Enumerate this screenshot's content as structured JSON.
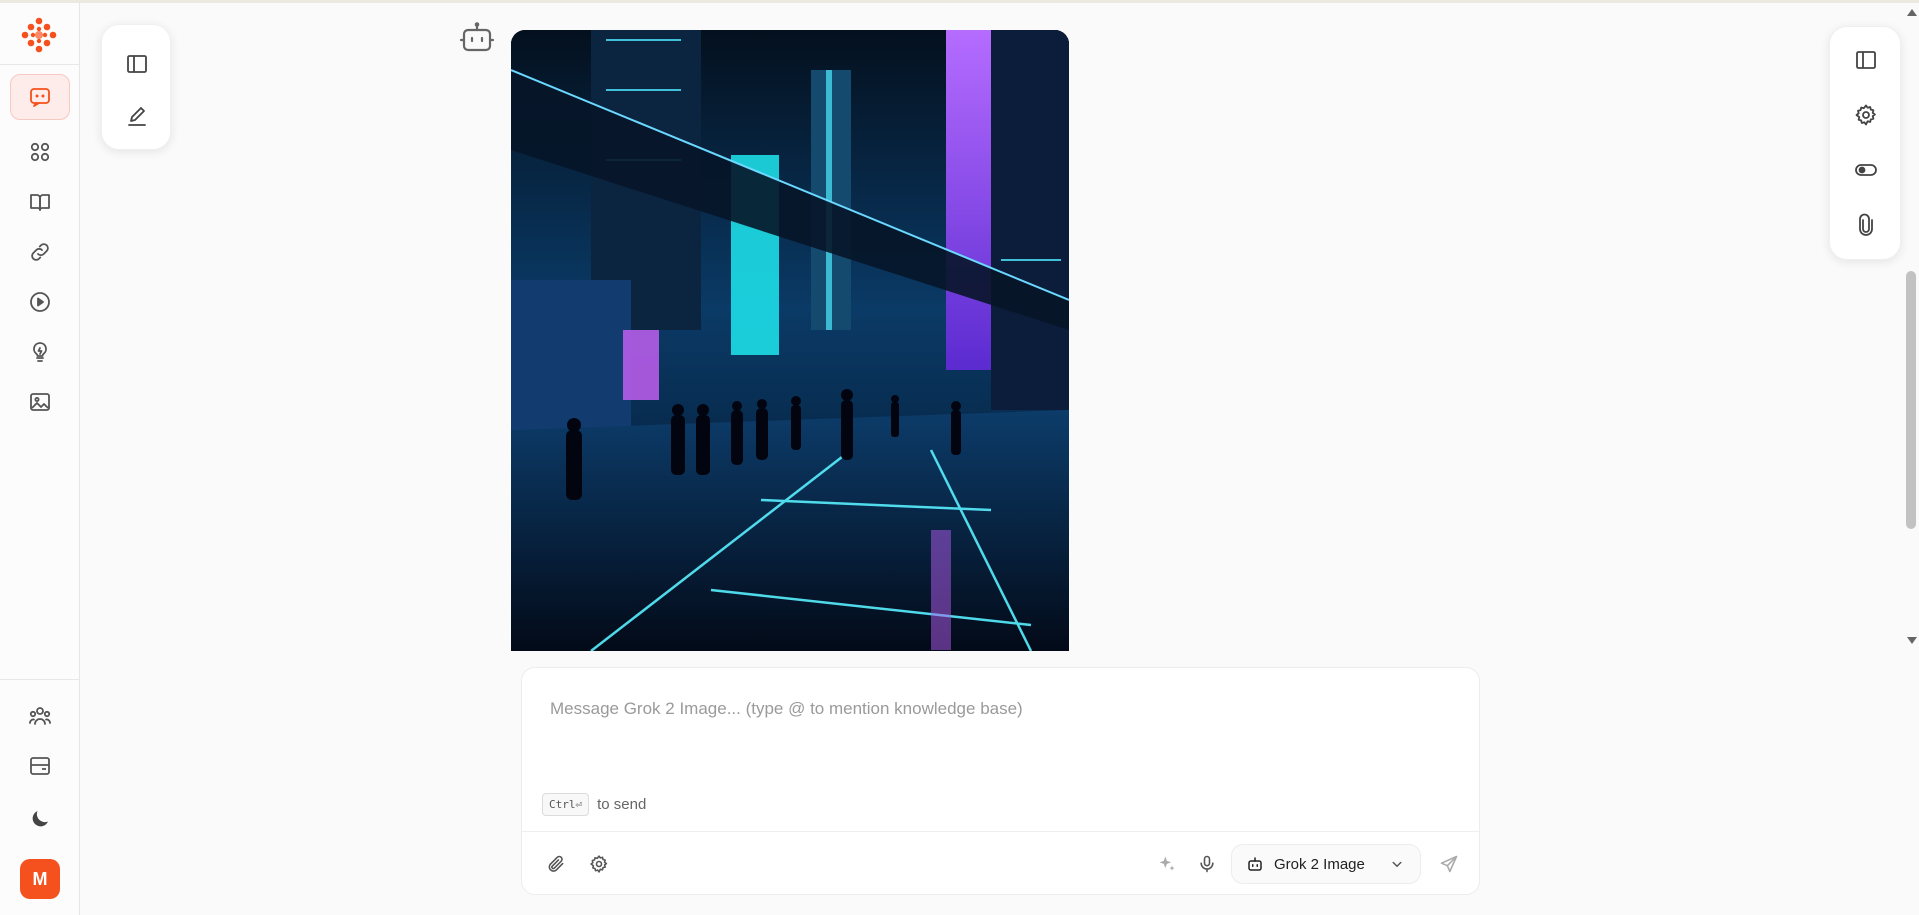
{
  "colors": {
    "accent": "#f4511e",
    "active_bg": "#fdecea",
    "icon": "#555555",
    "muted_icon": "#aaaaaa"
  },
  "sidebar": {
    "logo_icon": "flower-logo-icon",
    "items": [
      {
        "name": "chat",
        "icon": "chat-bubble-icon",
        "active": true
      },
      {
        "name": "discover",
        "icon": "grid-icon",
        "active": false
      },
      {
        "name": "knowledge",
        "icon": "book-icon",
        "active": false
      },
      {
        "name": "plugins",
        "icon": "link-icon",
        "active": false
      },
      {
        "name": "video",
        "icon": "play-icon",
        "active": false
      },
      {
        "name": "ideas",
        "icon": "lightbulb-icon",
        "active": false
      },
      {
        "name": "images",
        "icon": "image-icon",
        "active": false
      }
    ],
    "bottom_items": [
      {
        "name": "team",
        "icon": "team-icon"
      },
      {
        "name": "archive",
        "icon": "archive-icon"
      },
      {
        "name": "theme",
        "icon": "moon-icon"
      }
    ],
    "avatar_initial": "M"
  },
  "left_panel": {
    "buttons": [
      {
        "name": "toggle-sidebar",
        "icon": "sidebar-panel-icon"
      },
      {
        "name": "new-chat",
        "icon": "pencil-icon"
      }
    ]
  },
  "right_panel": {
    "buttons": [
      {
        "name": "toggle-right-panel",
        "icon": "sidebar-panel-icon"
      },
      {
        "name": "settings",
        "icon": "gear-icon"
      },
      {
        "name": "toggle",
        "icon": "toggle-icon"
      },
      {
        "name": "attachments",
        "icon": "paperclip-icon"
      }
    ]
  },
  "message": {
    "sender_icon": "robot-icon",
    "image_description_icon": "generated-image"
  },
  "composer": {
    "placeholder": "Message Grok 2 Image... (type @ to mention knowledge base)",
    "value": "",
    "shortcut_key": "Ctrl⏎",
    "shortcut_hint": "to send",
    "model_name": "Grok 2 Image"
  }
}
